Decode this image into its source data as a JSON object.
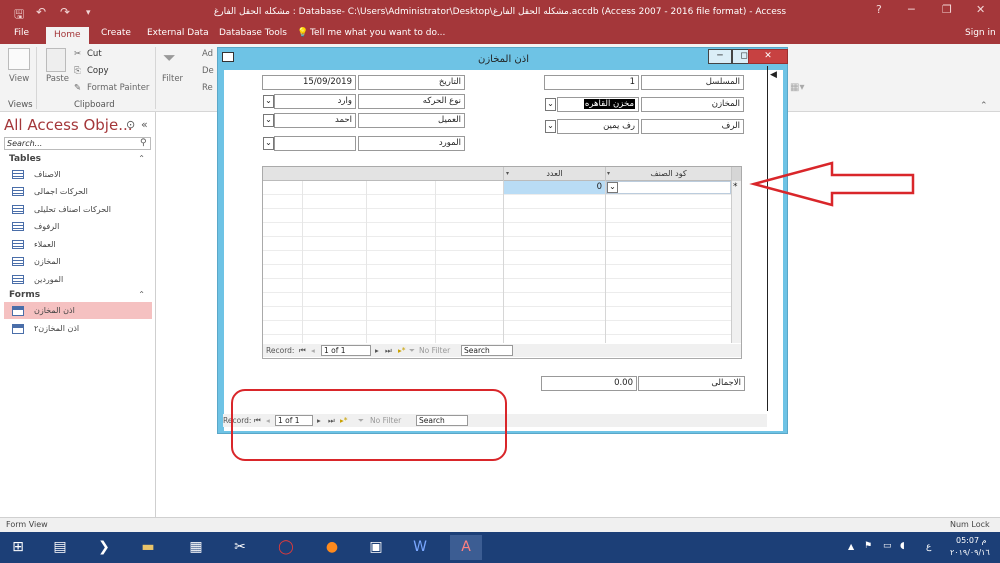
{
  "window": {
    "title": "مشكله الحقل الفارغ : Database- C:\\Users\\Administrator\\Desktop\\مشكله الحقل الفارغ.accdb (Access 2007 - 2016 file format) - Access",
    "help_button": "?",
    "minimize_button": "─",
    "restore_button": "❐",
    "close_button": "✕"
  },
  "menu": {
    "tabs": [
      "File",
      "Home",
      "Create",
      "External Data",
      "Database Tools"
    ],
    "tell_me": "Tell me what you want to do...",
    "sign_in": "Sign in"
  },
  "ribbon": {
    "view_label": "View",
    "paste_label": "Paste",
    "cut_label": "Cut",
    "copy_label": "Copy",
    "format_painter_label": "Format Painter",
    "filter_label": "Filter",
    "group_views": "Views",
    "group_clipboard": "Clipboard",
    "partial_labels": [
      "Ad",
      "De",
      "Re"
    ]
  },
  "nav": {
    "title": "All Access Obje...",
    "search_placeholder": "Search...",
    "tables_header": "Tables",
    "tables": [
      "الاصناف",
      "الحركات اجمالى",
      "الحركات اصناف تحليلى",
      "الرفوف",
      "العملاء",
      "المخازن",
      "الموردين"
    ],
    "forms_header": "Forms",
    "forms": [
      "اذن المخازن",
      "اذن المخازن٢"
    ]
  },
  "form": {
    "title": "اذن المخازن",
    "fields": {
      "serial_label": "المسلسل",
      "serial_value": "1",
      "warehouses_label": "المخازن",
      "warehouses_value": "مخزن القاهره",
      "shelf_label": "الرف",
      "shelf_value": "رف يمين",
      "date_label": "التاريخ",
      "date_value": "15/09/2019",
      "movement_label": "نوع الحركه",
      "movement_value": "وارد",
      "client_label": "العميل",
      "client_value": "احمد",
      "supplier_label": "المورد",
      "supplier_value": ""
    },
    "subform": {
      "col_item_code": "كود الصنف",
      "col_count": "العدد",
      "new_row_marker": "*",
      "count_default": "0",
      "record_label": "Record:",
      "record_position": "1 of 1",
      "no_filter": "No Filter",
      "search": "Search"
    },
    "total_label": "الاجمالى",
    "total_value": "0.00",
    "record_label": "Record:",
    "record_position": "1 of 1",
    "no_filter": "No Filter",
    "search": "Search"
  },
  "status": {
    "left": "Form View",
    "right": "Num Lock"
  },
  "taskbar": {
    "clock_time": "05:07 م",
    "clock_date": "٢٠١٩/٠٩/١٦",
    "lang": "ع"
  },
  "colors": {
    "access_red": "#a4373a",
    "form_frame": "#6ec3e5",
    "annotation_red": "#d9262a",
    "taskbar": "#1c3f77"
  }
}
